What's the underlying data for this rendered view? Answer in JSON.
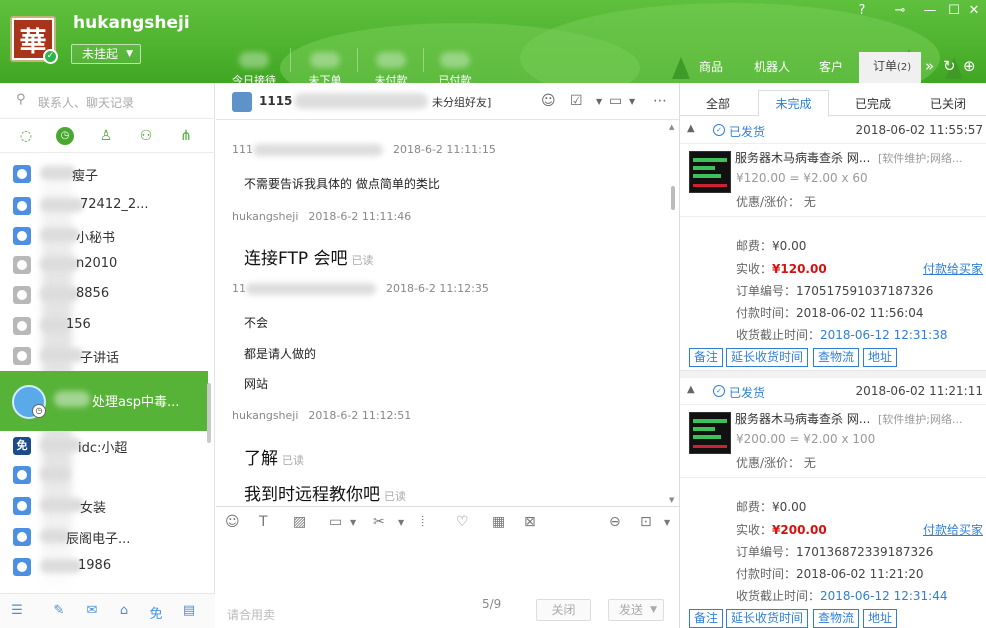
{
  "header": {
    "logo_text": "華",
    "username": "hukangsheji",
    "status": "未挂起",
    "stats": [
      "今日接待",
      "未下单",
      "未付款",
      "已付款"
    ],
    "tabs": [
      "商品",
      "机器人",
      "客户"
    ],
    "order_tab": "订单",
    "order_count": "(2)"
  },
  "left": {
    "search_placeholder": "联系人、聊天记录",
    "contacts": [
      {
        "name": "瘦子",
        "gray": false
      },
      {
        "name": "72412_2...",
        "gray": false
      },
      {
        "name": "小秘书",
        "gray": false
      },
      {
        "name": "n2010",
        "gray": true
      },
      {
        "name": "8856",
        "gray": true
      },
      {
        "name": "156",
        "gray": true
      },
      {
        "name": "子讲话",
        "gray": true
      },
      {
        "name": "idc:小超",
        "gray": false
      },
      {
        "name": "",
        "gray": false
      },
      {
        "name": "女装",
        "gray": false
      },
      {
        "name": "辰阁电子...",
        "gray": false
      },
      {
        "name": "1986",
        "gray": false
      }
    ],
    "active_contact": "处理asp中毒...",
    "bottom_badge": "免"
  },
  "chat": {
    "contact_name": "1115",
    "group_label": "未分组好友]",
    "messages": [
      {
        "sender": "111",
        "time": "2018-6-2 11:11:15",
        "lines": [
          "不需要告诉我具体的    做点简单的类比"
        ],
        "big": false,
        "read": false
      },
      {
        "sender": "hukangsheji",
        "time": "2018-6-2 11:11:46",
        "lines": [
          "连接FTP 会吧"
        ],
        "big": true,
        "read": true
      },
      {
        "sender": "11",
        "time": "2018-6-2 11:12:35",
        "lines": [
          "不会",
          "都是请人做的",
          "网站"
        ],
        "big": false,
        "read": false
      },
      {
        "sender": "hukangsheji",
        "time": "2018-6-2 11:12:51",
        "lines": [
          "了解",
          "我到时远程教你吧"
        ],
        "big": true,
        "read": true
      }
    ],
    "read_label": "已读",
    "input_placeholder": "请合用卖",
    "page_indicator": "5/9",
    "close_label": "关闭",
    "send_label": "发送"
  },
  "orders": {
    "tabs": [
      "全部",
      "未完成",
      "已完成",
      "已关闭"
    ],
    "active_tab": "未完成",
    "cards": [
      {
        "status": "已发货",
        "time": "2018-06-02 11:55:57",
        "title": "服务器木马病毒查杀 网...",
        "category": "[软件维护;网络...",
        "price": "¥120.00 = ¥2.00 x 60",
        "discount": "优惠/涨价： 无",
        "postage_label": "邮费：",
        "postage": "¥0.00",
        "paid_label": "实收：",
        "paid": "¥120.00",
        "pay_link": "付款给买家",
        "order_no_label": "订单编号：",
        "order_no": "170517591037187326",
        "pay_time_label": "付款时间：",
        "pay_time": "2018-06-02 11:56:04",
        "deadline_label": "收货截止时间：",
        "deadline": "2018-06-12 12:31:38",
        "actions": [
          "备注",
          "延长收货时间",
          "查物流",
          "地址"
        ]
      },
      {
        "status": "已发货",
        "time": "2018-06-02 11:21:11",
        "title": "服务器木马病毒查杀 网...",
        "category": "[软件维护;网络...",
        "price": "¥200.00 = ¥2.00 x 100",
        "discount": "优惠/涨价： 无",
        "postage_label": "邮费：",
        "postage": "¥0.00",
        "paid_label": "实收：",
        "paid": "¥200.00",
        "pay_link": "付款给买家",
        "order_no_label": "订单编号：",
        "order_no": "170136872339187326",
        "pay_time_label": "付款时间：",
        "pay_time": "2018-06-02 11:21:20",
        "deadline_label": "收货截止时间：",
        "deadline": "2018-06-12 12:31:44",
        "actions": [
          "备注",
          "延长收货时间",
          "查物流",
          "地址"
        ]
      }
    ]
  },
  "colors": {
    "brand_green": "#4db22d",
    "link_blue": "#2f7fd8",
    "price_red": "#d6100f"
  }
}
